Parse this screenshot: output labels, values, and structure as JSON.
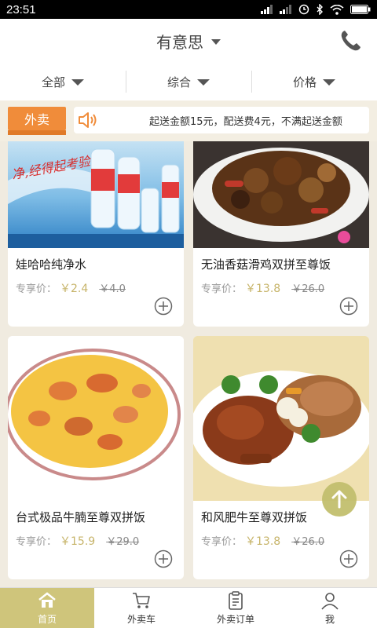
{
  "status": {
    "time": "23:51"
  },
  "header": {
    "title": "有意思"
  },
  "filters": [
    {
      "label": "全部"
    },
    {
      "label": "综合"
    },
    {
      "label": "价格"
    }
  ],
  "notice": {
    "tag": "外卖",
    "text": "起送金额15元，配送费4元，不满起送金额"
  },
  "products": [
    {
      "name": "娃哈哈纯净水",
      "price_label": "专享价：",
      "price": "￥2.4",
      "original": "￥4.0"
    },
    {
      "name": "无油香菇滑鸡双拼至尊饭",
      "price_label": "专享价：",
      "price": "￥13.8",
      "original": "￥26.0"
    },
    {
      "name": "台式极品牛腩至尊双拼饭",
      "price_label": "专享价：",
      "price": "￥15.9",
      "original": "￥29.0"
    },
    {
      "name": "和风肥牛至尊双拼饭",
      "price_label": "专享价：",
      "price": "￥13.8",
      "original": "￥26.0"
    }
  ],
  "tabs": [
    {
      "label": "首页",
      "icon": "home-icon",
      "active": true
    },
    {
      "label": "外卖车",
      "icon": "cart-icon"
    },
    {
      "label": "外卖订单",
      "icon": "clipboard-icon"
    },
    {
      "label": "我",
      "icon": "person-icon"
    }
  ],
  "colors": {
    "accent": "#cfc57b",
    "tag": "#f08c3a",
    "price": "#c7b46a"
  }
}
